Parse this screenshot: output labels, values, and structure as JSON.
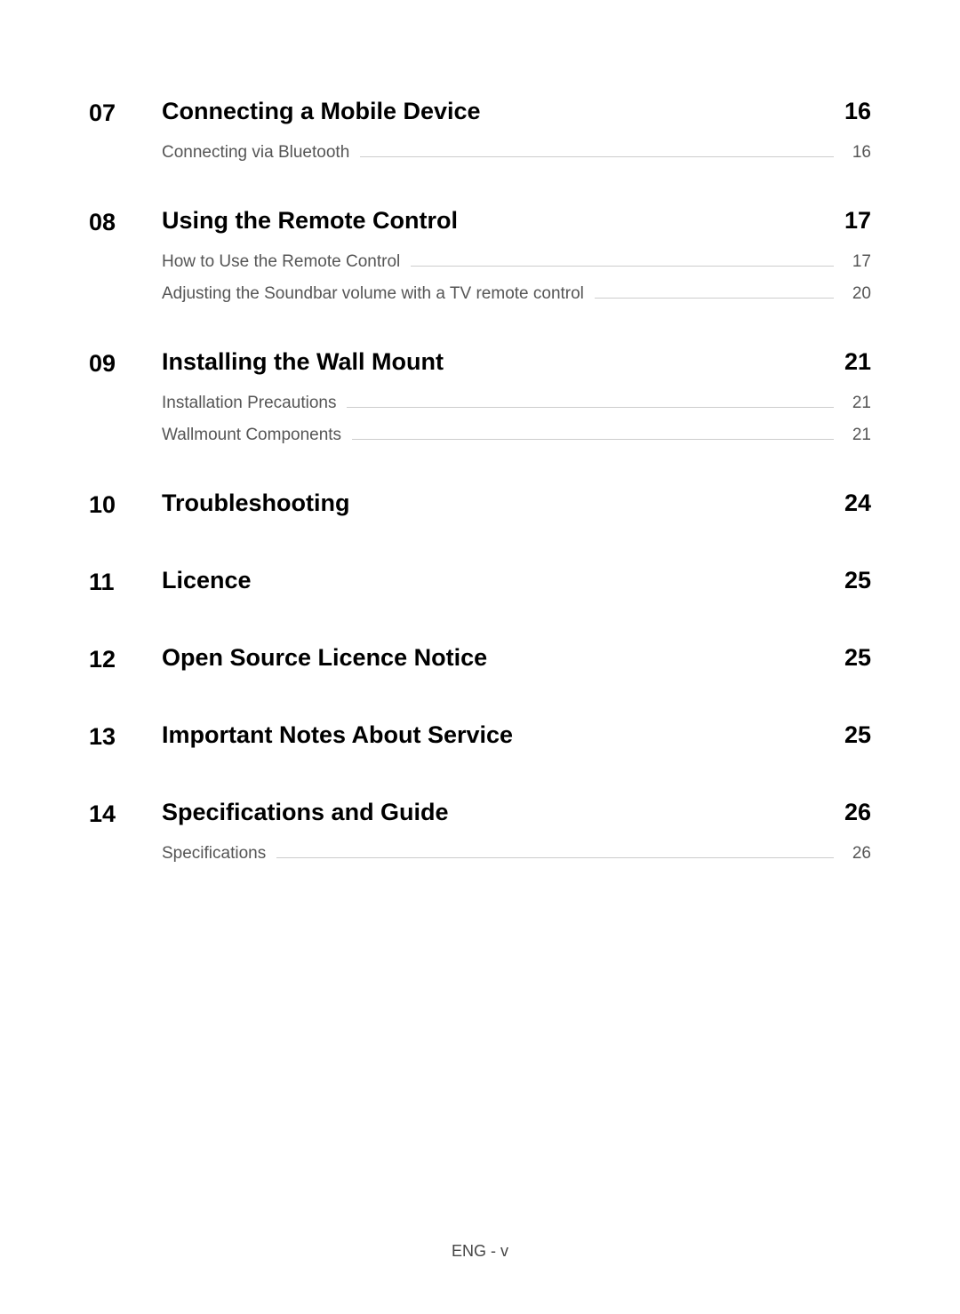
{
  "sections": [
    {
      "number": "07",
      "title": "Connecting a Mobile Device",
      "page": "16",
      "subsections": [
        {
          "title": "Connecting via Bluetooth",
          "page": "16"
        }
      ]
    },
    {
      "number": "08",
      "title": "Using the Remote Control",
      "page": "17",
      "subsections": [
        {
          "title": "How to Use the Remote Control",
          "page": "17"
        },
        {
          "title": "Adjusting the Soundbar volume with a TV remote control",
          "page": "20"
        }
      ]
    },
    {
      "number": "09",
      "title": "Installing the Wall Mount",
      "page": "21",
      "subsections": [
        {
          "title": "Installation Precautions",
          "page": "21"
        },
        {
          "title": "Wallmount Components",
          "page": "21"
        }
      ]
    },
    {
      "number": "10",
      "title": "Troubleshooting",
      "page": "24",
      "subsections": []
    },
    {
      "number": "11",
      "title": "Licence",
      "page": "25",
      "subsections": []
    },
    {
      "number": "12",
      "title": "Open Source Licence Notice",
      "page": "25",
      "subsections": []
    },
    {
      "number": "13",
      "title": "Important Notes About Service",
      "page": "25",
      "subsections": []
    },
    {
      "number": "14",
      "title": "Specifications and Guide",
      "page": "26",
      "subsections": [
        {
          "title": "Specifications",
          "page": "26"
        }
      ]
    }
  ],
  "footer": "ENG - v"
}
